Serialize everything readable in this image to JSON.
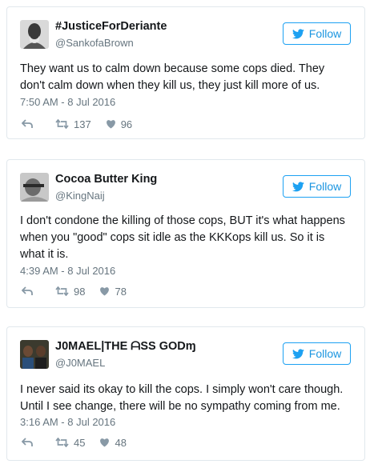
{
  "follow_label": "Follow",
  "colors": {
    "accent": "#1da1f2",
    "muted": "#66757f",
    "border": "#e1e8ed"
  },
  "icons": {
    "bird": "twitter-bird-icon",
    "reply": "reply-icon",
    "retweet": "retweet-icon",
    "like": "heart-icon"
  },
  "tweets": [
    {
      "name": "#JusticeForDeriante",
      "handle": "@SankofaBrown",
      "text": "They want us to calm down because some cops died. They don't calm down when they kill us, they just kill more of us.",
      "time": "7:50 AM - 8 Jul 2016",
      "retweets": "137",
      "likes": "96"
    },
    {
      "name": "Cocoa Butter King",
      "handle": "@KingNaij",
      "text": "I don't condone the killing of those cops, BUT it's what happens when you \"good\" cops sit idle as the KKKops kill us. So it is what it is.",
      "time": "4:39 AM - 8 Jul 2016",
      "retweets": "98",
      "likes": "78"
    },
    {
      "name": "J0MAEL|THE ᗩSS GODɱ",
      "handle": "@J0MAEL",
      "text": "I never said its okay to kill the cops. I simply won't care though. Until I see change, there will be no sympathy coming from me.",
      "time": "3:16 AM - 8 Jul 2016",
      "retweets": "45",
      "likes": "48"
    }
  ]
}
